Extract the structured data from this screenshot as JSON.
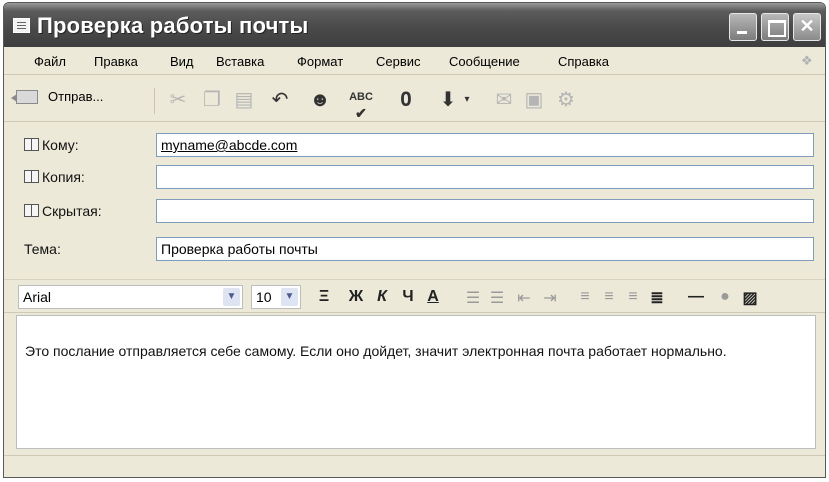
{
  "window": {
    "title": "Проверка работы почты"
  },
  "menu": {
    "items": [
      "Файл",
      "Правка",
      "Вид",
      "Вставка",
      "Формат",
      "Сервис",
      "Сообщение",
      "Справка"
    ]
  },
  "toolbar": {
    "send_label": "Отправ...",
    "spell_label": "ABC"
  },
  "fields": {
    "to_label": "Кому:",
    "to_value": "myname@abcde.com",
    "cc_label": "Копия:",
    "cc_value": "",
    "bcc_label": "Скрытая:",
    "bcc_value": "",
    "subject_label": "Тема:",
    "subject_value": "Проверка работы почты"
  },
  "format": {
    "font": "Arial",
    "size": "10",
    "bold": "Ж",
    "italic": "К",
    "underline": "Ч",
    "color": "А"
  },
  "message": {
    "body": "Это послание отправляется себе самому. Если оно дойдет, значит электронная почта работает нормально."
  },
  "colors": {
    "titlebar": "#4a4a4a",
    "chrome": "#ece9d8",
    "field_border": "#7f9db9"
  }
}
